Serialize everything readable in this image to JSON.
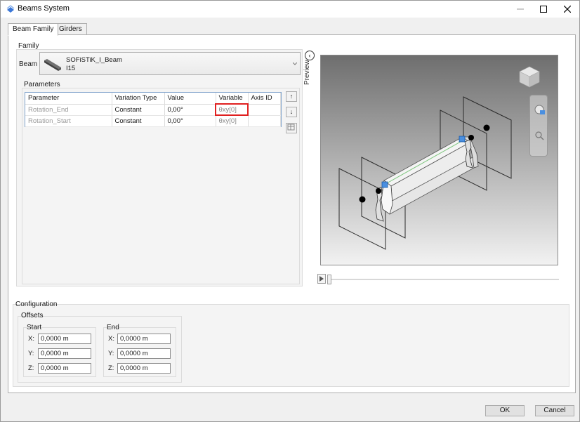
{
  "window": {
    "title": "Beams System"
  },
  "tabs": [
    {
      "label": "Beam Family",
      "active": true
    },
    {
      "label": "Girders",
      "active": false
    }
  ],
  "family": {
    "group_label": "Family",
    "beam_label": "Beam",
    "beam_name": "SOFiSTiK_I_Beam",
    "beam_type": "I15"
  },
  "parameters": {
    "group_label": "Parameters",
    "columns": [
      "Parameter",
      "Variation Type",
      "Value",
      "Variable",
      "Axis ID"
    ],
    "rows": [
      {
        "parameter": "Rotation_End",
        "variation": "Constant",
        "value": "0,00°",
        "variable": "θxy[0]",
        "axis": ""
      },
      {
        "parameter": "Rotation_Start",
        "variation": "Constant",
        "value": "0,00°",
        "variable": "θxy[0]",
        "axis": ""
      }
    ],
    "up_glyph": "↑",
    "down_glyph": "↓"
  },
  "preview": {
    "label": "Preview",
    "toggle_glyph": "‹"
  },
  "configuration": {
    "group_label": "Configuration",
    "offsets_label": "Offsets",
    "start": {
      "label": "Start",
      "x_label": "X:",
      "y_label": "Y:",
      "z_label": "Z:",
      "x": "0,0000 m",
      "y": "0,0000 m",
      "z": "0,0000 m"
    },
    "end": {
      "label": "End",
      "x_label": "X:",
      "y_label": "Y:",
      "z_label": "Z:",
      "x": "0,0000 m",
      "y": "0,0000 m",
      "z": "0,0000 m"
    }
  },
  "buttons": {
    "ok": "OK",
    "cancel": "Cancel"
  },
  "colors": {
    "accent": "#3c78d8",
    "highlight_box": "#e02020",
    "viewport_top": "#6e6e6e",
    "viewport_bottom": "#f2f2f2"
  }
}
